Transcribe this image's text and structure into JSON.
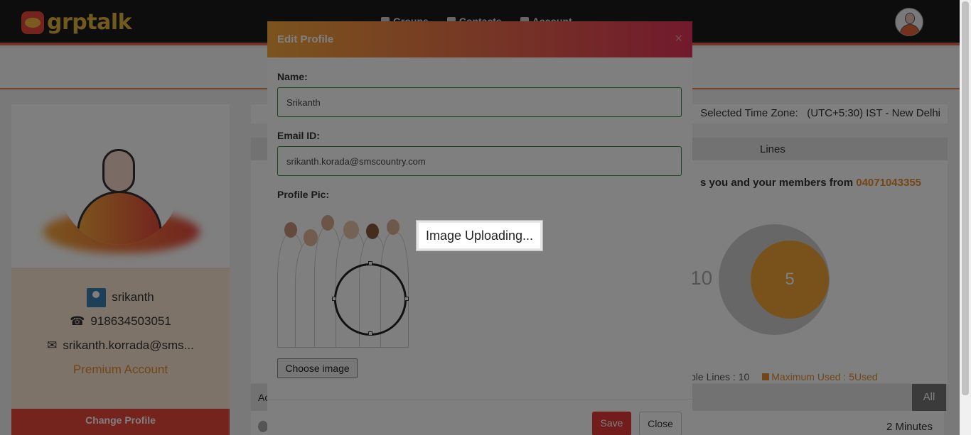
{
  "app": {
    "logo_text": "grptalk"
  },
  "nav": {
    "items": [
      "Groups",
      "Contacts",
      "Account"
    ]
  },
  "profile": {
    "name": "srikanth",
    "phone": "918634503051",
    "email": "srikanth.korrada@sms...",
    "account_type": "Premium Account",
    "change_profile_label": "Change Profile"
  },
  "timezone": {
    "label": "Selected Time Zone:",
    "value": "(UTC+5:30) IST - New Delhi"
  },
  "lines": {
    "header": "Lines",
    "members_text": "s you and your members from",
    "number": "04071043355",
    "total": "10",
    "used": "5",
    "legend_available": "ble Lines : 10",
    "legend_max": "Maximum Used : 5Used"
  },
  "activity": {
    "label": "Ac",
    "all_label": "All",
    "row_time": "2 Minutes"
  },
  "modal": {
    "title": "Edit Profile",
    "close_symbol": "×",
    "name_label": "Name:",
    "name_value": "Srikanth",
    "email_label": "Email ID:",
    "email_value": "srikanth.korada@smscountry.com",
    "pic_label": "Profile Pic:",
    "uploading_text": "Image Uploading...",
    "choose_label": "Choose image",
    "save_label": "Save",
    "close_label": "Close"
  },
  "colors": {
    "accent": "#e48c2d",
    "brand_red": "#e8493b",
    "input_border": "#2f8a3a"
  }
}
